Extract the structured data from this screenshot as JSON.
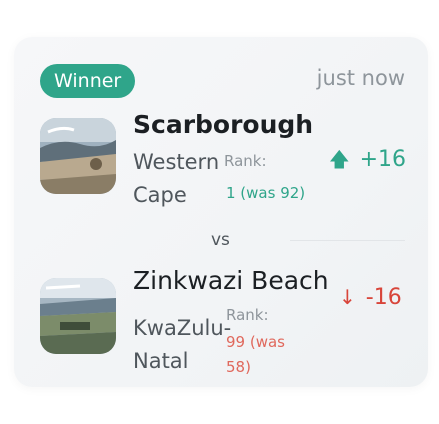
{
  "header": {
    "badge_label": "Winner",
    "timestamp": "just now"
  },
  "winner": {
    "name": "Scarborough",
    "region": "Western Cape",
    "rank_label": "Rank:",
    "rank_value": "1 (was 92)",
    "delta": "+16",
    "delta_icon": "arrow-up-icon",
    "delta_color": "#2fa58a",
    "thumbnail": "scarborough-beach-photo"
  },
  "separator": {
    "label": "vs"
  },
  "loser": {
    "name": "Zinkwazi Beach",
    "region": "KwaZulu-Natal",
    "rank_label": "Rank:",
    "rank_value": "99 (was 58)",
    "delta": "-16",
    "delta_icon": "arrow-down-icon",
    "delta_color": "#d8453a",
    "thumbnail": "zinkwazi-beach-photo"
  },
  "colors": {
    "accent": "#2fa58a",
    "negative": "#d8453a",
    "muted": "#8e959b"
  }
}
